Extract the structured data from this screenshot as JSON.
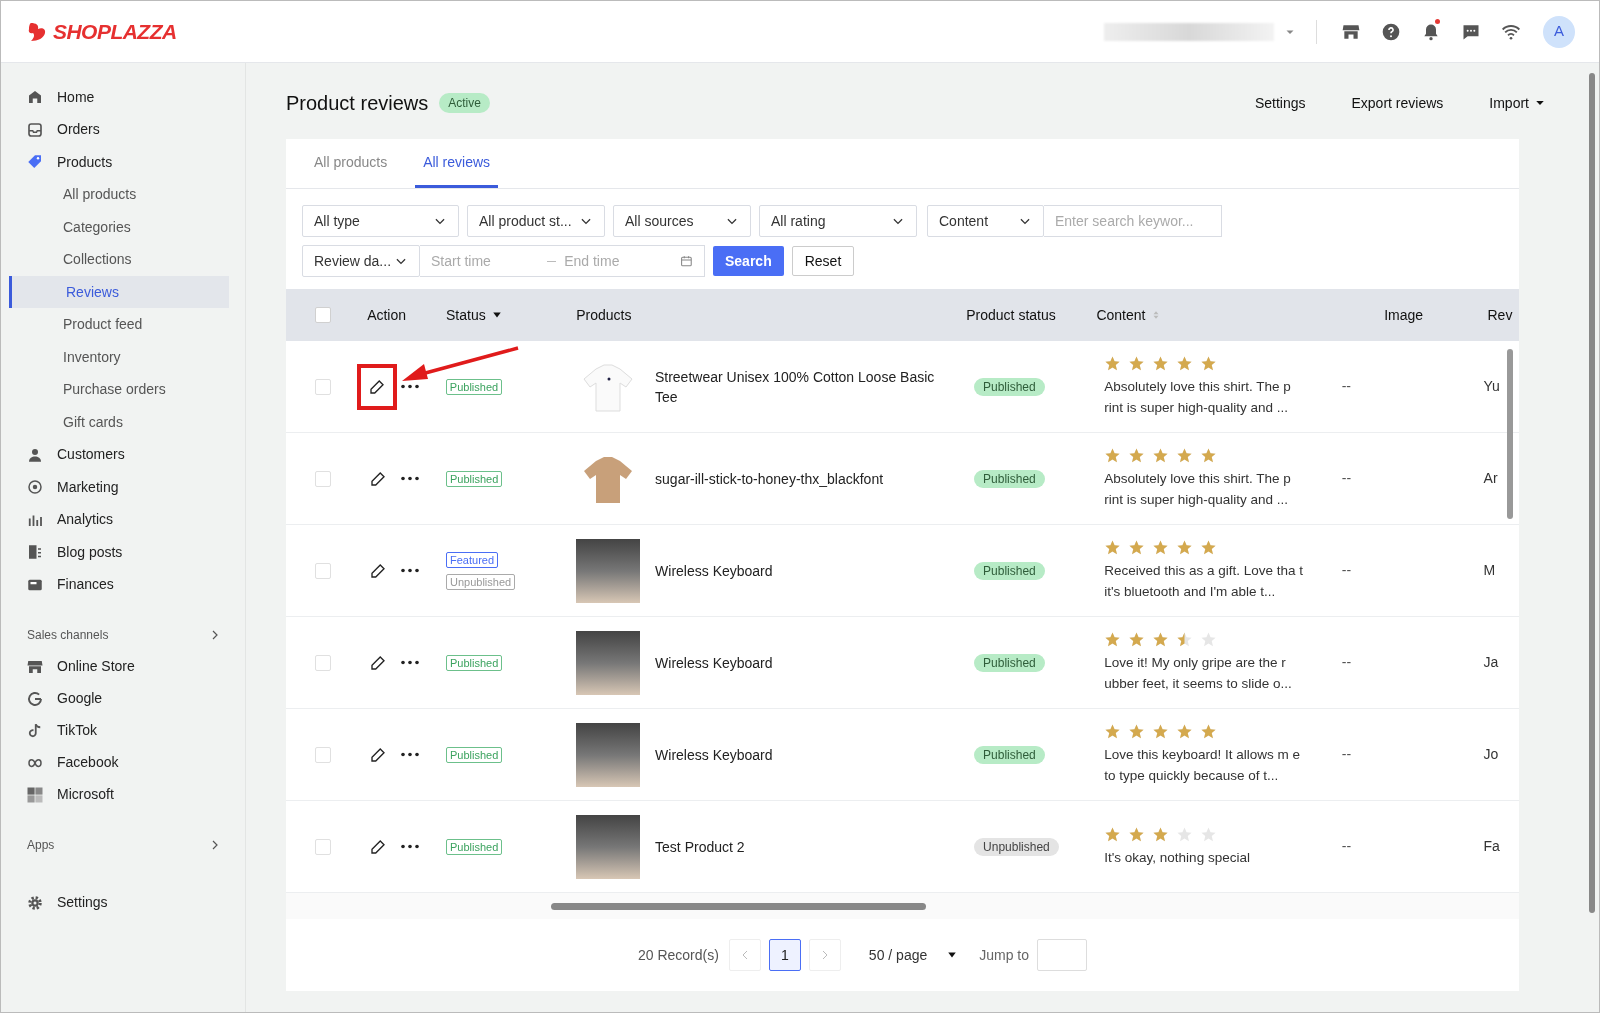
{
  "header": {
    "logo": "SHOPLAZZA",
    "avatar": "A",
    "notification_dot": true
  },
  "sidebar": {
    "items": [
      {
        "label": "Home",
        "selected": false
      },
      {
        "label": "Orders",
        "selected": false
      },
      {
        "label": "Products",
        "selected": false,
        "expanded": true,
        "children": [
          {
            "label": "All products",
            "selected": false
          },
          {
            "label": "Categories",
            "selected": false
          },
          {
            "label": "Collections",
            "selected": false
          },
          {
            "label": "Reviews",
            "selected": true
          },
          {
            "label": "Product feed",
            "selected": false
          },
          {
            "label": "Inventory",
            "selected": false
          },
          {
            "label": "Purchase orders",
            "selected": false
          },
          {
            "label": "Gift cards",
            "selected": false
          }
        ]
      },
      {
        "label": "Customers",
        "selected": false
      },
      {
        "label": "Marketing",
        "selected": false
      },
      {
        "label": "Analytics",
        "selected": false
      },
      {
        "label": "Blog posts",
        "selected": false
      },
      {
        "label": "Finances",
        "selected": false
      }
    ],
    "sections": [
      {
        "title": "Sales channels",
        "items": [
          {
            "label": "Online Store",
            "selected": false
          },
          {
            "label": "Google",
            "selected": false
          },
          {
            "label": "TikTok",
            "selected": false
          },
          {
            "label": "Facebook",
            "selected": false
          },
          {
            "label": "Microsoft",
            "selected": false
          }
        ]
      },
      {
        "title": "Apps"
      }
    ],
    "footer": {
      "label": "Settings",
      "selected": false
    }
  },
  "page": {
    "title": "Product reviews",
    "badge": "Active",
    "actions": [
      "Settings",
      "Export reviews",
      "Import"
    ]
  },
  "tabs": [
    {
      "label": "All products",
      "selected": false
    },
    {
      "label": "All reviews",
      "selected": true
    }
  ],
  "filters": {
    "selects": [
      "All type",
      "All product st...",
      "All sources",
      "All rating"
    ],
    "content_select": "Content",
    "search": {
      "placeholder": "Enter search keywor..."
    },
    "date_select": "Review da...",
    "start": {
      "placeholder": "Start time"
    },
    "end": {
      "placeholder": "End time"
    },
    "buttons": [
      "Search",
      "Reset"
    ]
  },
  "table": {
    "all_checked": false,
    "columns": [
      "Action",
      "Status",
      "Products",
      "Product status",
      "Content",
      "Image",
      "Rev"
    ],
    "rows": [
      {
        "checked": false,
        "highlighted": true,
        "status_tags": [
          {
            "label": "Published",
            "kind": "published"
          }
        ],
        "product": "Streetwear Unisex 100% Cotton Loose Basic Tee",
        "product_status": {
          "label": "Published",
          "kind": "published"
        },
        "stars": 5,
        "content": "Absolutely love this shirt. The p rint is super high-quality and ...",
        "image": "--",
        "column_8": "Yu"
      },
      {
        "checked": false,
        "highlighted": false,
        "status_tags": [
          {
            "label": "Published",
            "kind": "published"
          }
        ],
        "product": "sugar-ill-stick-to-honey-thx_blackfont",
        "product_status": {
          "label": "Published",
          "kind": "published"
        },
        "stars": 5,
        "content": "Absolutely love this shirt. The p rint is super high-quality and ...",
        "image": "--",
        "column_8": "Ar"
      },
      {
        "checked": false,
        "highlighted": false,
        "status_tags": [
          {
            "label": "Featured",
            "kind": "featured"
          },
          {
            "label": "Unpublished",
            "kind": "unpublished"
          }
        ],
        "product": "Wireless Keyboard",
        "product_status": {
          "label": "Published",
          "kind": "published"
        },
        "stars": 5,
        "content": "Received this as a gift. Love tha t it's bluetooth and I'm able t...",
        "image": "--",
        "column_8": "M"
      },
      {
        "checked": false,
        "highlighted": false,
        "status_tags": [
          {
            "label": "Published",
            "kind": "published"
          }
        ],
        "product": "Wireless Keyboard",
        "product_status": {
          "label": "Published",
          "kind": "published"
        },
        "stars": 3.5,
        "content": "Love it! My only gripe are the r ubber feet, it seems to slide o...",
        "image": "--",
        "column_8": "Ja"
      },
      {
        "checked": false,
        "highlighted": false,
        "status_tags": [
          {
            "label": "Published",
            "kind": "published"
          }
        ],
        "product": "Wireless Keyboard",
        "product_status": {
          "label": "Published",
          "kind": "published"
        },
        "stars": 5,
        "content": "Love this keyboard! It allows m e to type quickly because of t...",
        "image": "--",
        "column_8": "Jo"
      },
      {
        "checked": false,
        "highlighted": false,
        "status_tags": [
          {
            "label": "Published",
            "kind": "published"
          }
        ],
        "product": "Test Product 2",
        "product_status": {
          "label": "Unpublished",
          "kind": "unpublished"
        },
        "stars": 3,
        "content": "It's okay, nothing special",
        "image": "--",
        "column_8": "Fa"
      }
    ]
  },
  "pagination": {
    "records": "20 Record(s)",
    "pages": [
      {
        "label": "1",
        "selected": true
      }
    ],
    "page_size": "50 / page",
    "jump_label": "Jump to"
  }
}
